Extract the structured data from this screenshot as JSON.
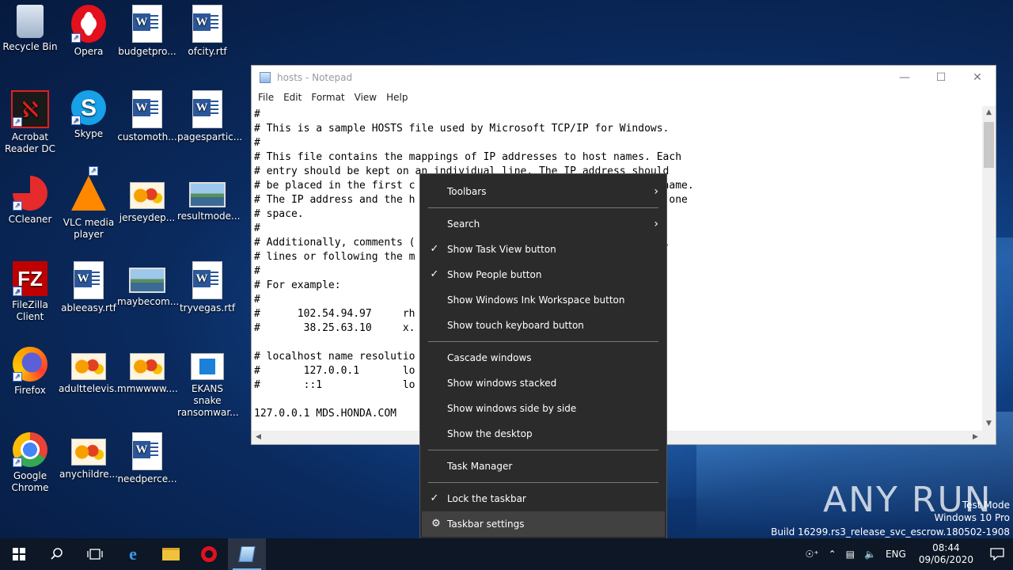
{
  "desktop": {
    "icons": [
      {
        "label": "Recycle Bin",
        "icon": "recycle-bin-icon"
      },
      {
        "label": "Opera",
        "icon": "opera-icon"
      },
      {
        "label": "budgetpro...",
        "icon": "word-document-icon"
      },
      {
        "label": "ofcity.rtf",
        "icon": "word-document-icon"
      },
      {
        "label": "Acrobat Reader DC",
        "icon": "acrobat-icon"
      },
      {
        "label": "Skype",
        "icon": "skype-icon"
      },
      {
        "label": "customoth...",
        "icon": "word-document-icon"
      },
      {
        "label": "pagespartic...",
        "icon": "word-document-icon"
      },
      {
        "label": "CCleaner",
        "icon": "ccleaner-icon"
      },
      {
        "label": "VLC media player",
        "icon": "vlc-icon"
      },
      {
        "label": "jerseydep...",
        "icon": "image-file-icon"
      },
      {
        "label": "resultmode...",
        "icon": "image-file-icon"
      },
      {
        "label": "FileZilla Client",
        "icon": "filezilla-icon"
      },
      {
        "label": "ableeasy.rtf",
        "icon": "word-document-icon"
      },
      {
        "label": "maybecom...",
        "icon": "image-file-icon"
      },
      {
        "label": "tryvegas.rtf",
        "icon": "word-document-icon"
      },
      {
        "label": "Firefox",
        "icon": "firefox-icon"
      },
      {
        "label": "adulttelevis...",
        "icon": "image-file-icon"
      },
      {
        "label": "mmwwww....",
        "icon": "image-file-icon"
      },
      {
        "label": "EKANS snake ransomwar...",
        "icon": "application-icon"
      },
      {
        "label": "Google Chrome",
        "icon": "chrome-icon"
      },
      {
        "label": "anychildre...",
        "icon": "image-file-icon"
      },
      {
        "label": "needperce...",
        "icon": "word-document-icon"
      }
    ]
  },
  "notepad": {
    "title": "hosts - Notepad",
    "menu": [
      "File",
      "Edit",
      "Format",
      "View",
      "Help"
    ],
    "lines": [
      "#",
      "# This is a sample HOSTS file used by Microsoft TCP/IP for Windows.",
      "#",
      "# This file contains the mappings of IP addresses to host names. Each",
      "# entry should be kept on an individual line. The IP address should",
      "# be placed in the first c                                      t name.",
      "# The IP address and the h                                       t one",
      "# space.",
      "#",
      "# Additionally, comments (                                    idual",
      "# lines or following the m",
      "#",
      "# For example:",
      "#",
      "#      102.54.94.97     rh",
      "#       38.25.63.10     x.",
      "",
      "# localhost name resolutio",
      "#       127.0.0.1       lo",
      "#       ::1             lo",
      "",
      "127.0.0.1 MDS.HONDA.COM"
    ]
  },
  "context_menu": {
    "items": [
      {
        "label": "Toolbars",
        "checked": false,
        "submenu": true
      },
      {
        "sep": true
      },
      {
        "label": "Search",
        "checked": false,
        "submenu": true
      },
      {
        "label": "Show Task View button",
        "checked": true
      },
      {
        "label": "Show People button",
        "checked": true
      },
      {
        "label": "Show Windows Ink Workspace button",
        "checked": false
      },
      {
        "label": "Show touch keyboard button",
        "checked": false
      },
      {
        "sep": true
      },
      {
        "label": "Cascade windows",
        "checked": false
      },
      {
        "label": "Show windows stacked",
        "checked": false
      },
      {
        "label": "Show windows side by side",
        "checked": false
      },
      {
        "label": "Show the desktop",
        "checked": false
      },
      {
        "sep": true
      },
      {
        "label": "Task Manager",
        "checked": false
      },
      {
        "sep": true
      },
      {
        "label": "Lock the taskbar",
        "checked": true
      },
      {
        "label": "Taskbar settings",
        "checked": false,
        "gear": true,
        "hover": true
      }
    ]
  },
  "watermark": {
    "logo": "ANY RUN",
    "mode": "Test Mode",
    "edition": "Windows 10 Pro",
    "build": "Build 16299.rs3_release_svc_escrow.180502-1908"
  },
  "taskbar": {
    "apps": [
      "start",
      "search",
      "task-view",
      "edge",
      "file-explorer",
      "opera",
      "notepad"
    ],
    "tray": {
      "language": "ENG",
      "time": "08:44",
      "date": "09/06/2020"
    }
  }
}
